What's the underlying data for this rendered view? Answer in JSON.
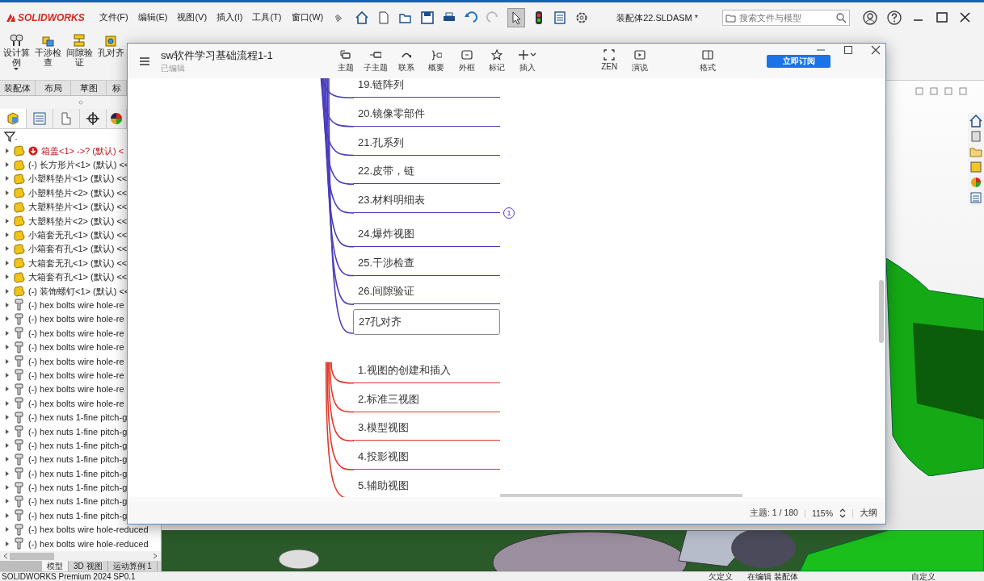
{
  "app": {
    "logo": "SOLIDWORKS",
    "menus": [
      "文件(F)",
      "编辑(E)",
      "视图(V)",
      "插入(I)",
      "工具(T)",
      "窗口(W)"
    ],
    "doc_title": "装配体22.SLDASM *",
    "search": {
      "placeholder": "搜索文件与模型"
    }
  },
  "command_bar": {
    "buttons": [
      {
        "label": "设计算例",
        "dropdown": true
      },
      {
        "label": "干涉检查",
        "dropdown": false
      },
      {
        "label": "间隙验证",
        "dropdown": false
      },
      {
        "label": "孔对齐",
        "dropdown": false
      }
    ]
  },
  "left_panel": {
    "tabs": [
      {
        "label": "装配体",
        "selected": false
      },
      {
        "label": "布局",
        "selected": false
      },
      {
        "label": "草图",
        "selected": false
      },
      {
        "label": "标",
        "selected": false
      }
    ],
    "view_tabs": [
      {
        "selected": true
      },
      {
        "selected": false
      },
      {
        "selected": false
      },
      {
        "selected": false
      },
      {
        "selected": false
      }
    ],
    "tree": [
      {
        "kind": "part",
        "error": true,
        "label": "箱盖<1> ->? (默认) <"
      },
      {
        "kind": "part",
        "error": false,
        "label": "(-) 长方形片<1> (默认) <<"
      },
      {
        "kind": "part",
        "error": false,
        "label": "小塑料垫片<1> (默认) <<"
      },
      {
        "kind": "part",
        "error": false,
        "label": "小塑料垫片<2> (默认) <<"
      },
      {
        "kind": "part",
        "error": false,
        "label": "大塑料垫片<1> (默认) <<"
      },
      {
        "kind": "part",
        "error": false,
        "label": "大塑料垫片<2> (默认) <<"
      },
      {
        "kind": "part",
        "error": false,
        "label": "小箱套无孔<1> (默认) <<"
      },
      {
        "kind": "part",
        "error": false,
        "label": "小箱套有孔<1> (默认) <<"
      },
      {
        "kind": "part",
        "error": false,
        "label": "大箱套无孔<1> (默认) <<"
      },
      {
        "kind": "part",
        "error": false,
        "label": "大箱套有孔<1> (默认) <<"
      },
      {
        "kind": "part",
        "error": false,
        "label": "(-) 装饰螺钉<1> (默认) <<"
      },
      {
        "kind": "fastener",
        "error": false,
        "label": "(-) hex bolts wire hole-re"
      },
      {
        "kind": "fastener",
        "error": false,
        "label": "(-) hex bolts wire hole-re"
      },
      {
        "kind": "fastener",
        "error": false,
        "label": "(-) hex bolts wire hole-re"
      },
      {
        "kind": "fastener",
        "error": false,
        "label": "(-) hex bolts wire hole-re"
      },
      {
        "kind": "fastener",
        "error": false,
        "label": "(-) hex bolts wire hole-re"
      },
      {
        "kind": "fastener",
        "error": false,
        "label": "(-) hex bolts wire hole-re"
      },
      {
        "kind": "fastener",
        "error": false,
        "label": "(-) hex bolts wire hole-re"
      },
      {
        "kind": "fastener",
        "error": false,
        "label": "(-) hex bolts wire hole-re"
      },
      {
        "kind": "fastener",
        "error": false,
        "label": "(-) hex nuts 1-fine pitch-g"
      },
      {
        "kind": "fastener",
        "error": false,
        "label": "(-) hex nuts 1-fine pitch-g"
      },
      {
        "kind": "fastener",
        "error": false,
        "label": "(-) hex nuts 1-fine pitch-g"
      },
      {
        "kind": "fastener",
        "error": false,
        "label": "(-) hex nuts 1-fine pitch-g"
      },
      {
        "kind": "fastener",
        "error": false,
        "label": "(-) hex nuts 1-fine pitch-g"
      },
      {
        "kind": "fastener",
        "error": false,
        "label": "(-) hex nuts 1-fine pitch-g"
      },
      {
        "kind": "fastener",
        "error": false,
        "label": "(-) hex nuts 1-fine pitch-g"
      },
      {
        "kind": "fastener",
        "error": false,
        "label": "(-) hex nuts 1-fine pitch-g"
      },
      {
        "kind": "fastener",
        "error": false,
        "label": "(-) hex bolts wire hole-reduced"
      },
      {
        "kind": "fastener",
        "error": false,
        "label": "(-) hex bolts wire hole-reduced"
      }
    ],
    "bottom_tabs": [
      {
        "label": "模型",
        "selected": true
      },
      {
        "label": "3D 视图",
        "selected": false
      },
      {
        "label": "运动算例 1",
        "selected": false
      }
    ]
  },
  "mindmap": {
    "title": "sw软件学习基础流程1-1",
    "subtitle": "已编辑",
    "tools": [
      {
        "label": "主题",
        "dropdown": false
      },
      {
        "label": "子主题",
        "dropdown": false
      },
      {
        "label": "联系",
        "dropdown": false
      },
      {
        "label": "概要",
        "dropdown": false
      },
      {
        "label": "外框",
        "dropdown": false
      },
      {
        "label": "标记",
        "dropdown": false
      },
      {
        "label": "插入",
        "dropdown": true
      }
    ],
    "view_tools": [
      {
        "label": "ZEN"
      },
      {
        "label": "演说"
      }
    ],
    "format": "格式",
    "subscribe": "立即订阅",
    "branches": [
      {
        "color": "#4a3cbd",
        "nodes": [
          {
            "text": "19.链阵列",
            "selected": false
          },
          {
            "text": "20.镜像零部件",
            "selected": false
          },
          {
            "text": "21.孔系列",
            "selected": false
          },
          {
            "text": "22.皮带，链",
            "selected": false
          },
          {
            "text": "23.材料明细表",
            "selected": false,
            "badge": "1"
          },
          {
            "text": "24.爆炸视图",
            "selected": false
          },
          {
            "text": "25.干涉检查",
            "selected": false
          },
          {
            "text": "26.间隙验证",
            "selected": false
          },
          {
            "text": "27孔对齐",
            "selected": true
          }
        ]
      },
      {
        "color": "#e0392b",
        "nodes": [
          {
            "text": "1.视图的创建和插入",
            "selected": false
          },
          {
            "text": "2.标准三视图",
            "selected": false
          },
          {
            "text": "3.模型视图",
            "selected": false
          },
          {
            "text": "4.投影视图",
            "selected": false
          },
          {
            "text": "5.辅助视图",
            "selected": false
          }
        ]
      }
    ],
    "status": {
      "topic_count": "主题: 1 / 180",
      "zoom": "115%",
      "outline": "大纲"
    }
  },
  "status_bar": {
    "product": "SOLIDWORKS Premium 2024 SP0.1",
    "state": "欠定义",
    "editing": "在编辑 装配体",
    "units": "自定义"
  }
}
